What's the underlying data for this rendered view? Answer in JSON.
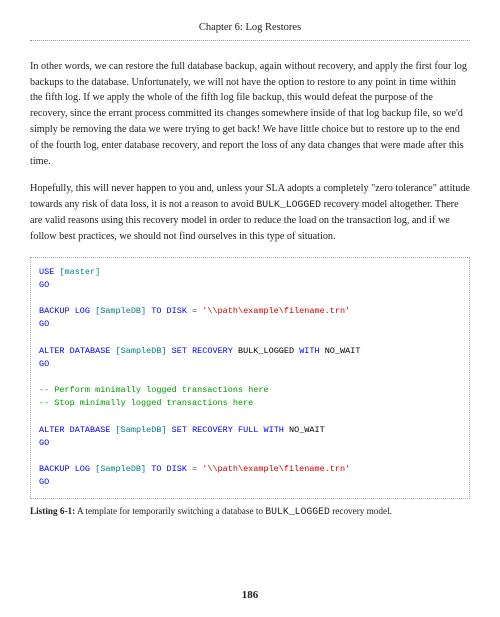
{
  "header": {
    "chapter_title": "Chapter 6: Log Restores"
  },
  "body": {
    "p1a": "In other words, we can restore the full database backup, again without recovery, and apply the first four log backups to the database. Unfortunately, we will not have the option to restore to any point in time within the fifth log. If we apply the whole of the fifth log file backup, this would defeat the purpose of the recovery, since the errant process committed its changes somewhere inside of that log backup file, so we'd simply be removing the data we were trying to get back! We have little choice but to restore up to the end of the fourth log, enter database recovery, and report the loss of any data changes that were made after this time.",
    "p2a": "Hopefully, this will never happen to you and, unless your SLA adopts a completely \"zero tolerance\" attitude towards any risk of data loss, it is not a reason to avoid ",
    "p2b": "BULK_LOGGED",
    "p2c": " recovery model altogether. There are valid reasons using this recovery model in order to reduce the load on the transaction log, and if we follow best practices, we should not find ourselves in this type of situation."
  },
  "code": {
    "l1_use": "USE",
    "l1_master": " [master]",
    "l2_go": "GO",
    "l4_backup": "BACKUP",
    "l4_log": " LOG",
    "l4_mid": " [SampleDB] ",
    "l4_to": "TO",
    "l4_disk": " DISK ",
    "l4_eq": "=",
    "l4_path": " '\\\\path\\example\\filename.trn'",
    "l5_go": "GO",
    "l7_alter": "ALTER",
    "l7_db": " DATABASE",
    "l7_mid": " [SampleDB] ",
    "l7_set": "SET",
    "l7_rec": " RECOVERY",
    "l7_bulk": " BULK_LOGGED ",
    "l7_with": "WITH",
    "l7_nowait": " NO_WAIT",
    "l8_go": "GO",
    "l10_c": "-- Perform minimally logged transactions here",
    "l11_c": "-- Stop minimally logged transactions here",
    "l13_alter": "ALTER",
    "l13_db": " DATABASE",
    "l13_mid": " [SampleDB] ",
    "l13_set": "SET",
    "l13_rec": " RECOVERY",
    "l13_full": " FULL ",
    "l13_with": "WITH",
    "l13_nowait": " NO_WAIT",
    "l14_go": "GO",
    "l16_backup": "BACKUP",
    "l16_log": " LOG",
    "l16_mid": " [SampleDB] ",
    "l16_to": "TO",
    "l16_disk": " DISK ",
    "l16_eq": "=",
    "l16_path": " '\\\\path\\example\\filename.trn'",
    "l17_go": "GO"
  },
  "listing": {
    "label": "Listing 6-1:",
    "caption_a": "   A template for temporarily switching a database to ",
    "caption_b": "BULK_LOGGED",
    "caption_c": " recovery model."
  },
  "page_number": "186"
}
